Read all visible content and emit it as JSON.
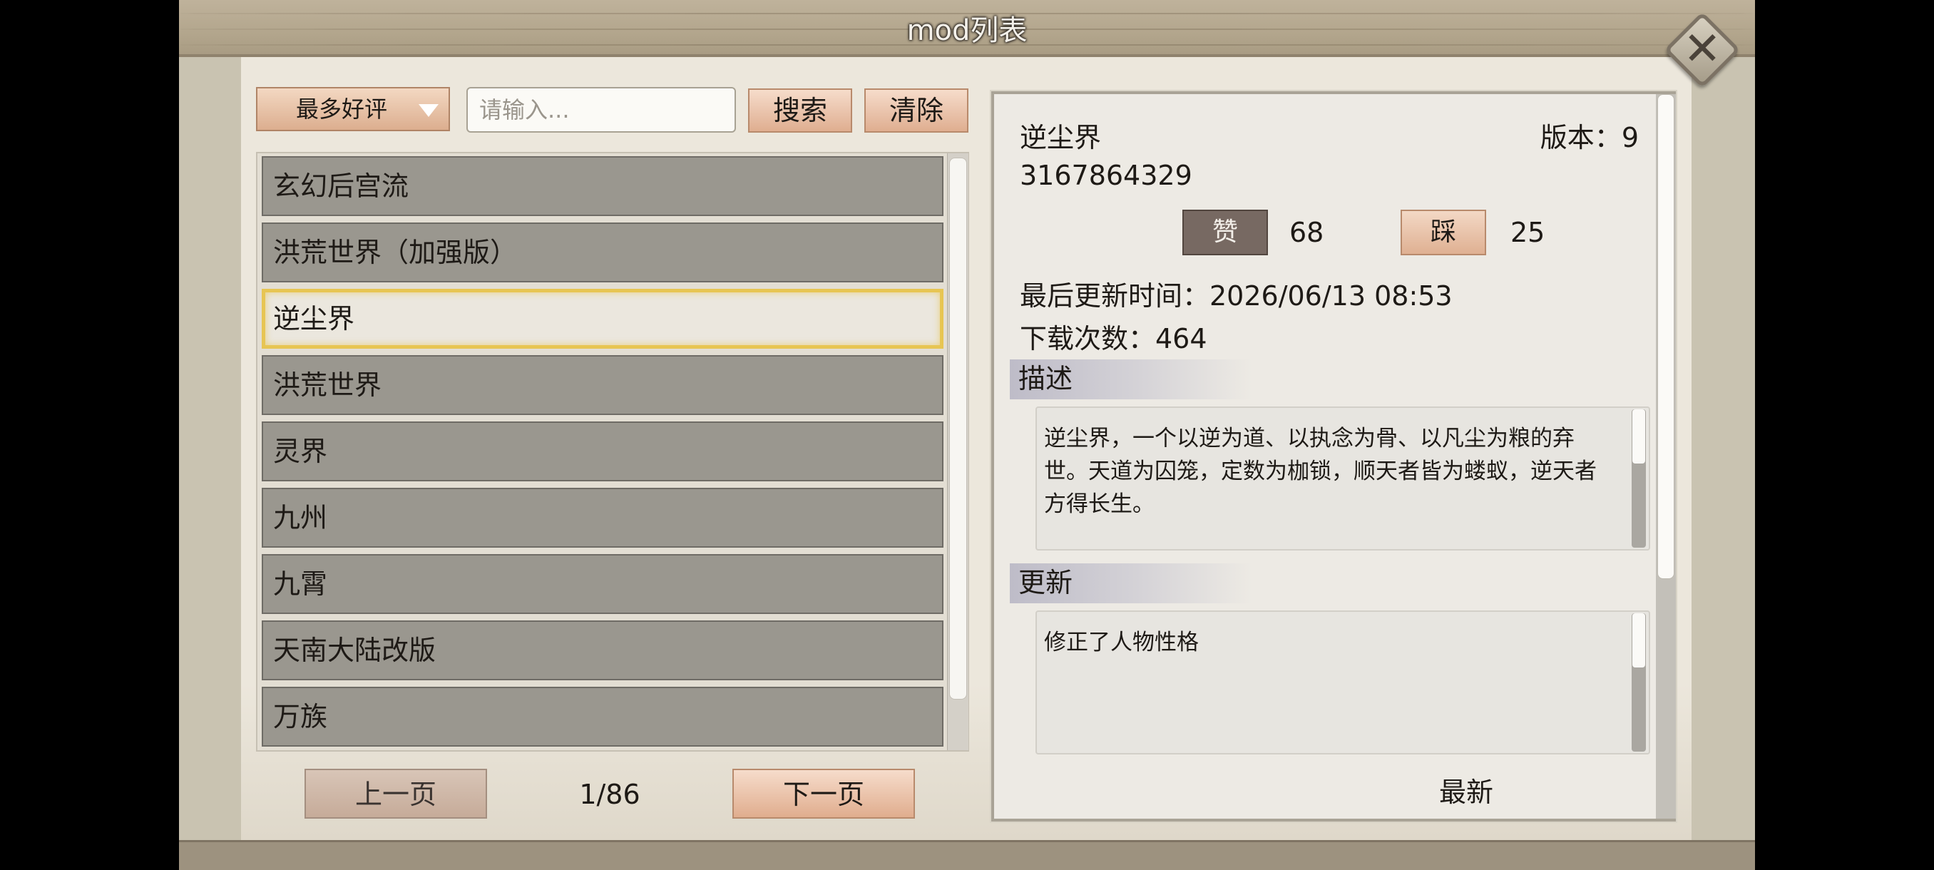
{
  "window": {
    "title": "mod列表",
    "close_icon": "✕"
  },
  "toolbar": {
    "sort_selected": "最多好评",
    "search_placeholder": "请输入...",
    "search_label": "搜索",
    "clear_label": "清除"
  },
  "mod_list": {
    "items": [
      {
        "label": "玄幻后宫流",
        "selected": false
      },
      {
        "label": "洪荒世界（加强版）",
        "selected": false
      },
      {
        "label": "逆尘界",
        "selected": true
      },
      {
        "label": "洪荒世界",
        "selected": false
      },
      {
        "label": "灵界",
        "selected": false
      },
      {
        "label": "九州",
        "selected": false
      },
      {
        "label": "九霄",
        "selected": false
      },
      {
        "label": "天南大陆改版",
        "selected": false
      },
      {
        "label": "万族",
        "selected": false
      }
    ]
  },
  "pagination": {
    "prev_label": "上一页",
    "next_label": "下一页",
    "indicator": "1/86"
  },
  "detail": {
    "name": "逆尘界",
    "version_label": "版本：",
    "version_value": "9",
    "id": "3167864329",
    "like_label": "赞",
    "like_count": "68",
    "dislike_label": "踩",
    "dislike_count": "25",
    "update_time": "最后更新时间：2026/06/13 08:53",
    "downloads": "下载次数：464",
    "description_header": "描述",
    "description_text": "逆尘界，一个以逆为道、以执念为骨、以凡尘为粮的弃世。天道为囚笼，定数为枷锁，顺天者皆为蝼蚁，逆天者方得长生。",
    "update_header": "更新",
    "update_text": "修正了人物性格",
    "latest_label": "最新"
  },
  "colors": {
    "selected_border": "#e7c553",
    "list_item_bg": "#9a978f",
    "tan_button": "#dfae90",
    "like_button": "#776962"
  }
}
